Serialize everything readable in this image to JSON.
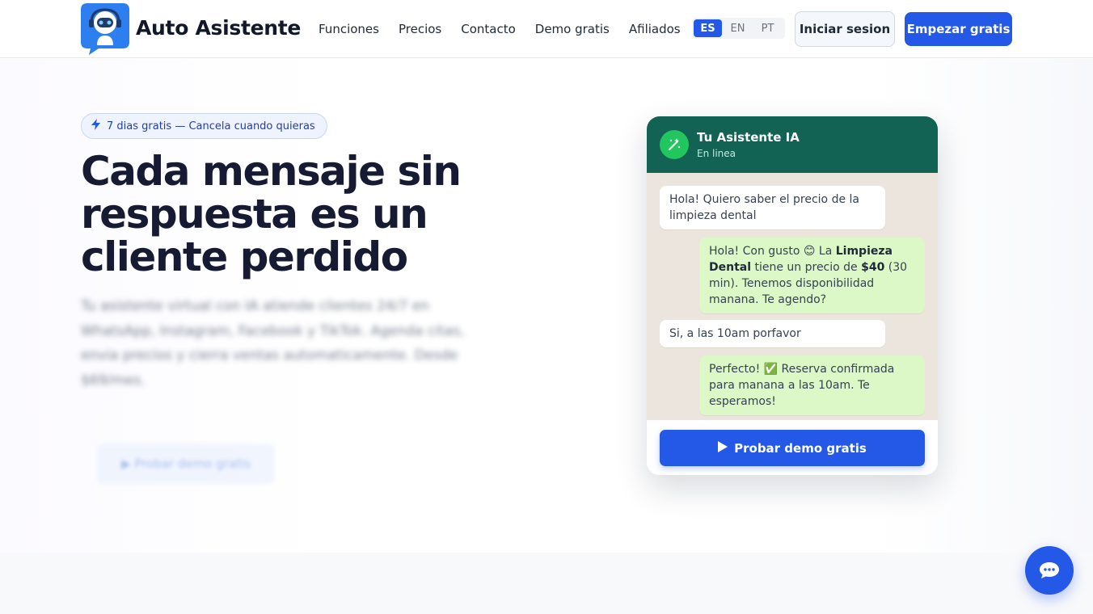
{
  "header": {
    "brand": "Auto Asistente",
    "nav": [
      "Funciones",
      "Precios",
      "Contacto",
      "Demo gratis",
      "Afiliados"
    ],
    "languages": [
      "ES",
      "EN",
      "PT"
    ],
    "active_language": "ES",
    "login_label": "Iniciar sesion",
    "start_label": "Empezar gratis"
  },
  "hero": {
    "badge": "7 dias gratis — Cancela cuando quieras",
    "headline": "Cada mensaje sin respuesta es un cliente perdido",
    "subtext": "Tu asistente virtual con IA atiende clientes 24/7 en WhatsApp, Instagram, Facebook y TikTok. Agenda citas, envia precios y cierra ventas automaticamente. Desde $69/mes.",
    "ghost_button": "Probar demo gratis"
  },
  "chat": {
    "title": "Tu Asistente IA",
    "status": "En linea",
    "messages": {
      "m1": "Hola! Quiero saber el precio de la limpieza dental",
      "m2_a": "Hola! Con gusto 😊 La ",
      "m2_b": "Limpieza Dental",
      "m2_c": " tiene un precio de ",
      "m2_d": "$40",
      "m2_e": " (30 min). Tenemos disponibilidad manana. Te agendo?",
      "m3": "Si, a las 10am porfavor",
      "m4": "Perfecto! ✅ Reserva confirmada para manana a las 10am. Te esperamos!"
    },
    "cta": "Probar demo gratis"
  },
  "colors": {
    "primary": "#2458e6",
    "chat_header": "#136355",
    "chat_bg": "#ece5dd",
    "bubble_out": "#dcf8c6",
    "headline": "#161a33"
  },
  "icons": {
    "logo": "robot-headset-icon",
    "badge": "bolt-icon",
    "chat_avatar": "magic-wand-icon",
    "cta": "play-icon",
    "float": "chat-bubble-icon"
  }
}
